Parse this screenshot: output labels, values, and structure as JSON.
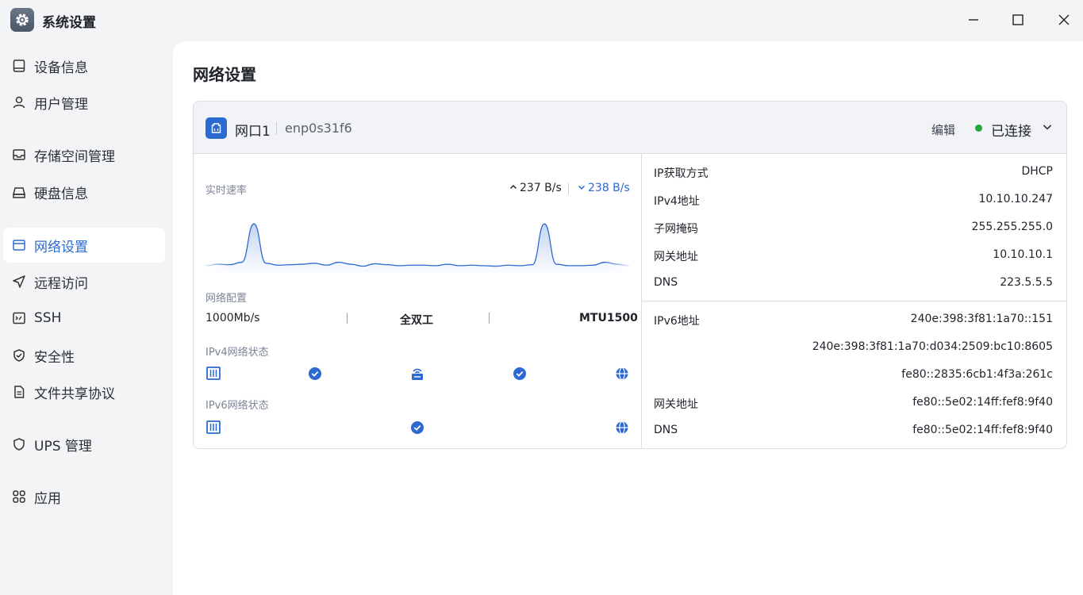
{
  "window": {
    "title": "系统设置"
  },
  "sidebar": {
    "items": [
      {
        "label": "设备信息",
        "icon": "device-icon"
      },
      {
        "label": "用户管理",
        "icon": "user-icon"
      },
      {
        "label": "存储空间管理",
        "icon": "storage-icon"
      },
      {
        "label": "硬盘信息",
        "icon": "disk-icon"
      },
      {
        "label": "网络设置",
        "icon": "network-icon",
        "active": true
      },
      {
        "label": "远程访问",
        "icon": "send-icon"
      },
      {
        "label": "SSH",
        "icon": "terminal-icon"
      },
      {
        "label": "安全性",
        "icon": "shield-check-icon"
      },
      {
        "label": "文件共享协议",
        "icon": "document-icon"
      },
      {
        "label": "UPS 管理",
        "icon": "shield-icon"
      },
      {
        "label": "应用",
        "icon": "apps-icon"
      }
    ]
  },
  "main": {
    "title": "网络设置",
    "card": {
      "port_name": "网口1",
      "device": "enp0s31f6",
      "edit_label": "编辑",
      "status": "已连接",
      "status_color": "#22a73f",
      "realtime": {
        "label": "实时速率",
        "upload": "237 B/s",
        "download": "238 B/s",
        "samples": [
          0.05,
          0.08,
          0.07,
          0.12,
          0.9,
          0.1,
          0.06,
          0.07,
          0.08,
          0.1,
          0.06,
          0.12,
          0.08,
          0.04,
          0.09,
          0.07,
          0.05,
          0.06,
          0.06,
          0.05,
          0.08,
          0.05,
          0.06,
          0.05,
          0.04,
          0.06,
          0.05,
          0.07,
          0.9,
          0.08,
          0.05,
          0.05,
          0.06,
          0.12,
          0.08,
          0.05
        ],
        "accent": "#2c6ad1"
      },
      "config": {
        "label": "网络配置",
        "speed": "1000Mb/s",
        "duplex": "全双工",
        "mtu": "MTU1500"
      },
      "ipv4_status_label": "IPv4网络状态",
      "ipv6_status_label": "IPv6网络状态",
      "ipv4_info": [
        {
          "key": "IP获取方式",
          "value": "DHCP"
        },
        {
          "key": "IPv4地址",
          "value": "10.10.10.247"
        },
        {
          "key": "子网掩码",
          "value": "255.255.255.0"
        },
        {
          "key": "网关地址",
          "value": "10.10.10.1"
        },
        {
          "key": "DNS",
          "value": "223.5.5.5"
        }
      ],
      "ipv6_info": [
        {
          "key": "IPv6地址",
          "value": "240e:398:3f81:1a70::151"
        },
        {
          "key": "",
          "value": "240e:398:3f81:1a70:d034:2509:bc10:8605"
        },
        {
          "key": "",
          "value": "fe80::2835:6cb1:4f3a:261c"
        },
        {
          "key": "网关地址",
          "value": "fe80::5e02:14ff:fef8:9f40"
        },
        {
          "key": "DNS",
          "value": "fe80::5e02:14ff:fef8:9f40"
        }
      ]
    }
  }
}
